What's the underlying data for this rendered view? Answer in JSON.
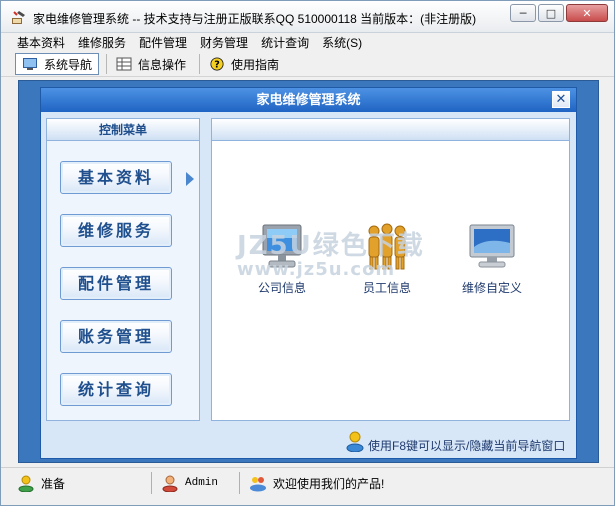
{
  "window": {
    "title": "家电维修管理系统 -- 技术支持与注册正版联系QQ 510000118   当前版本：(非注册版)",
    "minimize": "─",
    "maximize": "□",
    "close": "✕"
  },
  "menu": [
    "基本资料",
    "维修服务",
    "配件管理",
    "财务管理",
    "统计查询",
    "系统(S)"
  ],
  "toolbar": {
    "nav_label": "系统导航",
    "info_label": "信息操作",
    "help_label": "使用指南"
  },
  "dialog": {
    "title": "家电维修管理系统",
    "close": "✕",
    "left_header": "控制菜单",
    "nav_buttons": [
      "基本资料",
      "维修服务",
      "配件管理",
      "账务管理",
      "统计查询"
    ],
    "features": [
      {
        "label": "公司信息",
        "icon": "monitor-icon"
      },
      {
        "label": "员工信息",
        "icon": "staff-icon"
      },
      {
        "label": "维修自定义",
        "icon": "screen-icon"
      }
    ],
    "tip": "使用F8键可以显示/隐藏当前导航窗口"
  },
  "watermark": {
    "line1": "JZ5U绿色下载",
    "line2": "www.jz5u.com"
  },
  "status": {
    "ready": "准备",
    "user": "Admin",
    "welcome": "欢迎使用我们的产品!"
  },
  "colors": {
    "workspace": "#3b77bd",
    "dialog_title": "#1f64c3",
    "nav_text": "#1f4f8d"
  }
}
